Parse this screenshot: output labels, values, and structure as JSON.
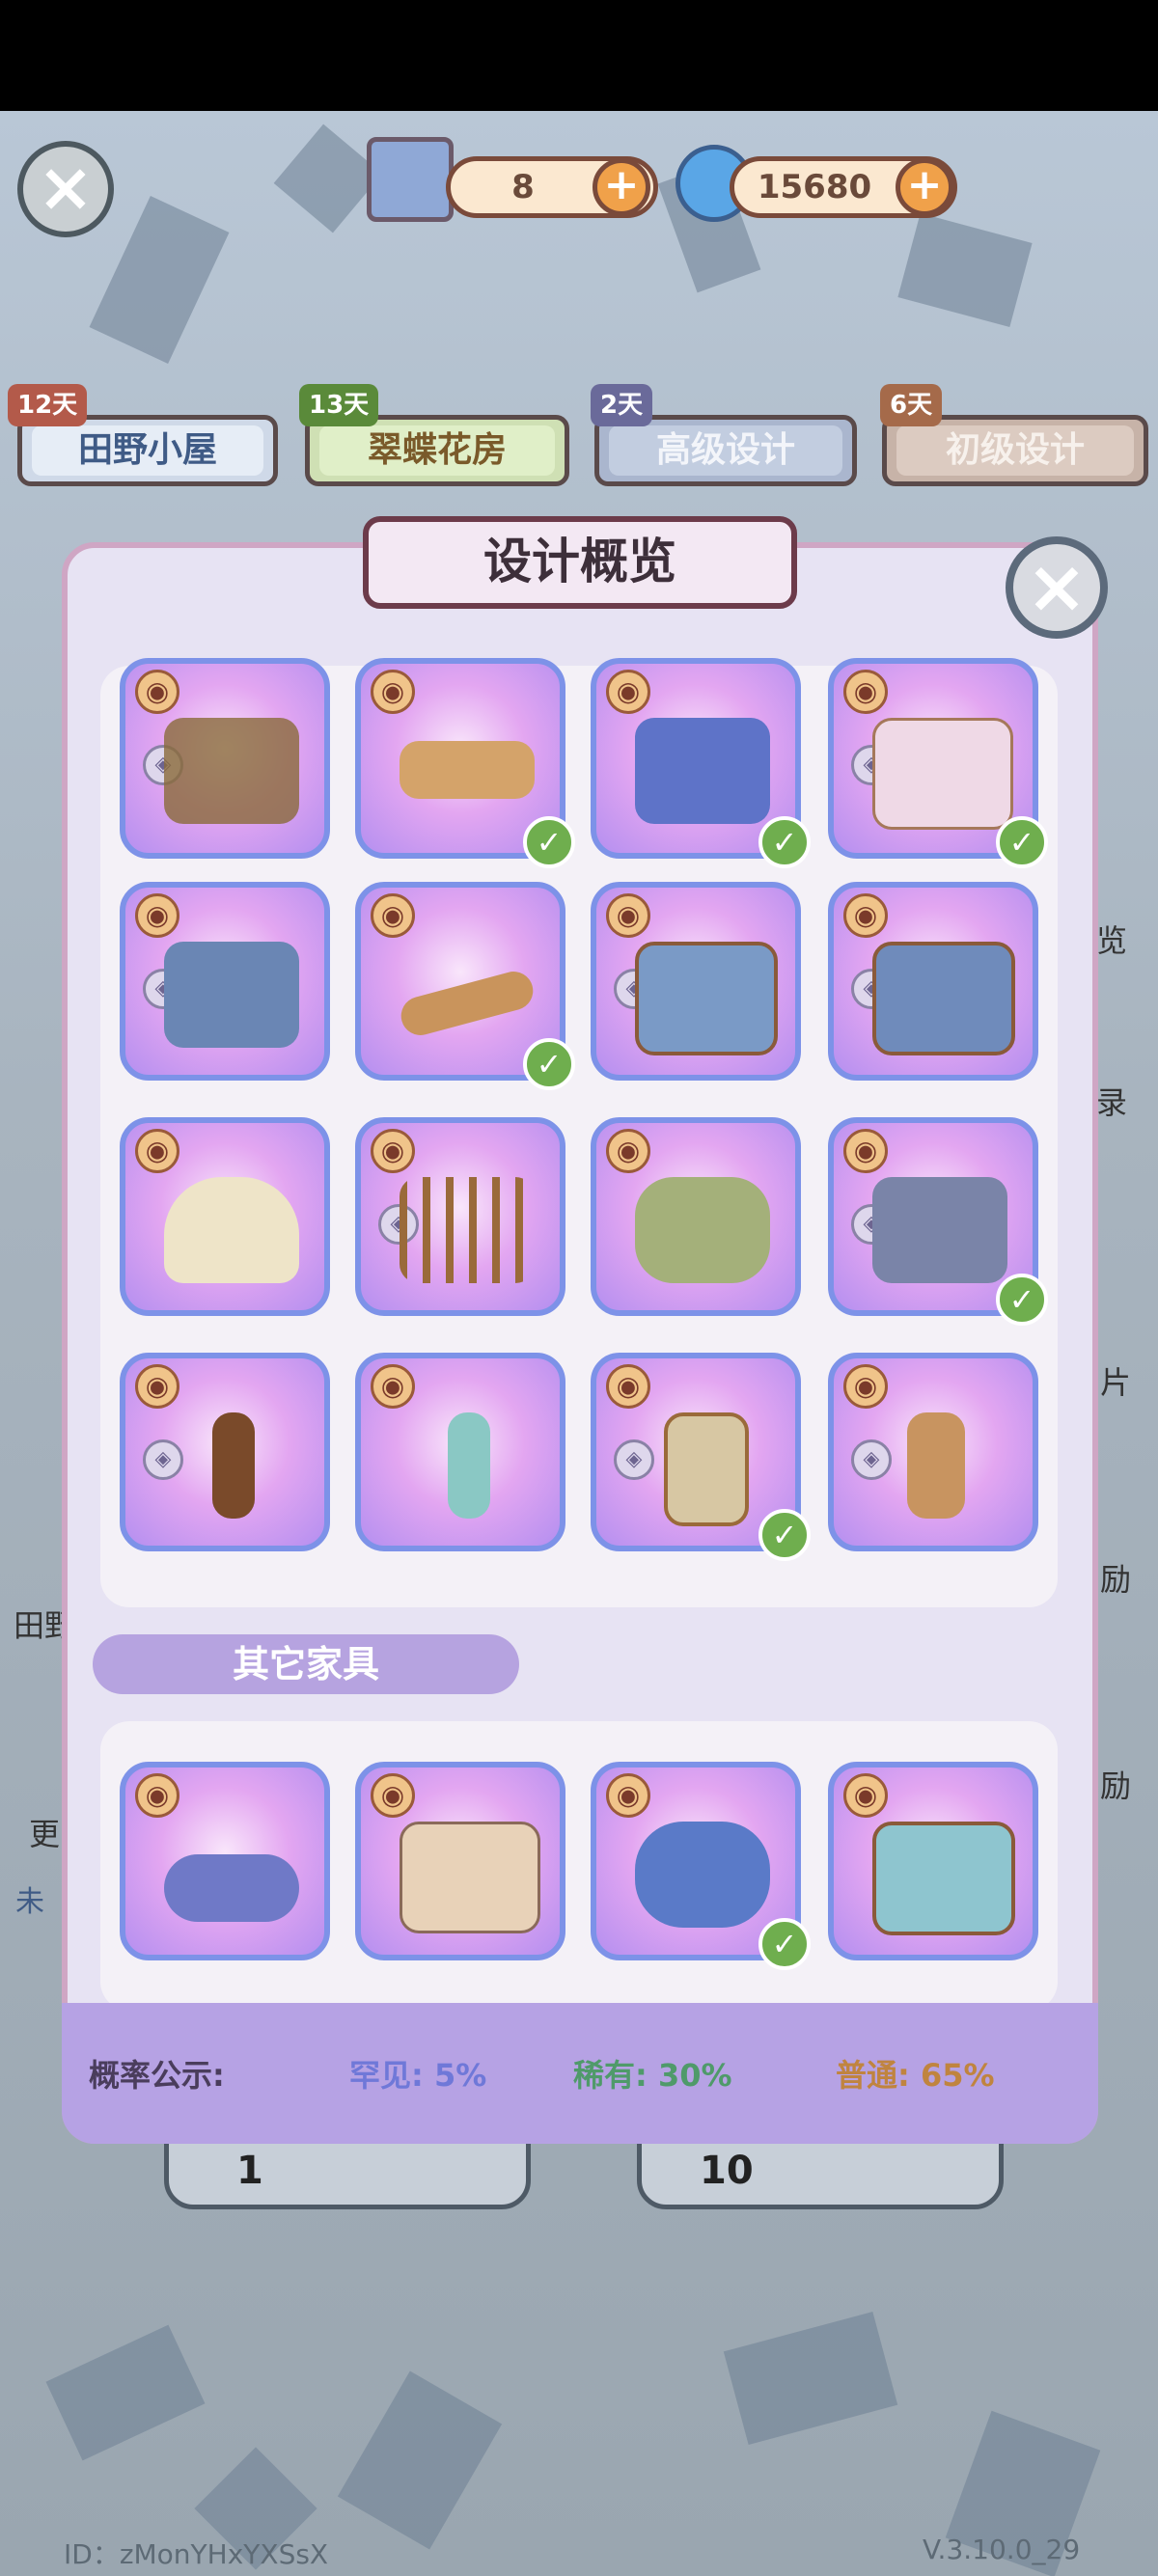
{
  "currency": {
    "tickets": "8",
    "coins": "15680"
  },
  "tabs": [
    {
      "days": "12天",
      "label": "田野小屋"
    },
    {
      "days": "13天",
      "label": "翠蝶花房"
    },
    {
      "days": "2天",
      "label": "高级设计"
    },
    {
      "days": "6天",
      "label": "初级设计"
    }
  ],
  "modal": {
    "title": "设计概览",
    "section_other": "其它家具"
  },
  "probability": {
    "label": "概率公示:",
    "rare_uncommon": "罕见: 5%",
    "rare": "稀有: 30%",
    "common": "普通: 65%"
  },
  "side_labels": {
    "a": "览",
    "b": "录",
    "c": "片",
    "d": "励",
    "e": "励",
    "left_a": "田野",
    "left_b": "更",
    "left_c": "未"
  },
  "bottom_counts": {
    "one": "1",
    "ten": "10"
  },
  "footer": {
    "id": "ID：zMonYHxYXSsX",
    "version": "V.3.10.0_29"
  },
  "colors": {
    "accent": "#b6a2e4",
    "rare_uncommon": "#6f78d8",
    "rare": "#4f9a6a",
    "common": "#c0843f"
  }
}
